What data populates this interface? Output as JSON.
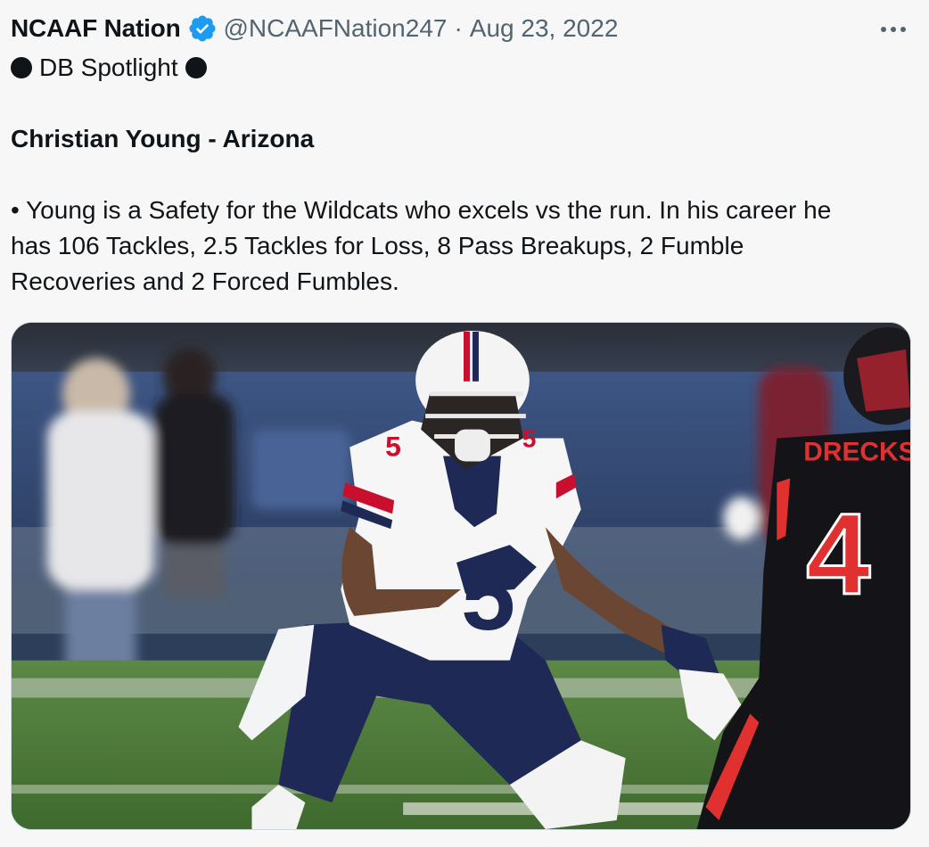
{
  "tweet": {
    "display_name": "NCAAF Nation",
    "handle": "@NCAAFNation247",
    "separator": "·",
    "date": "Aug 23, 2022",
    "verified_color": "#1d9bf0",
    "spotlight": "DB Spotlight",
    "headline": "Christian Young - Arizona",
    "body_lines": [
      "• Young is a Safety for the Wildcats who excels vs the run. In his career he",
      "has 106 Tackles, 2.5 Tackles for Loss, 8 Pass Breakups, 2 Fumble",
      "Recoveries and 2 Forced Fumbles."
    ]
  },
  "photo": {
    "subject": "football-photo",
    "helmet_number": "5",
    "opponent_number": "4",
    "colors": {
      "arizona_navy": "#1e2a55",
      "arizona_red": "#c8102e",
      "opponent_black": "#141418",
      "opponent_red": "#e03030",
      "turf": "#4e7a3a",
      "stadium_blue": "#33476e"
    }
  }
}
